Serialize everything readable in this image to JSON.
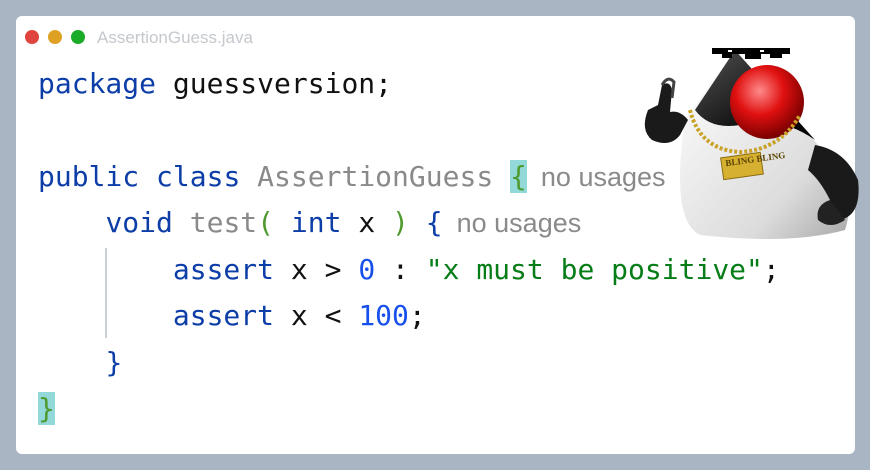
{
  "window": {
    "filename": "AssertionGuess.java"
  },
  "code": {
    "kw_package": "package",
    "package_rest": " guessversion;",
    "kw_public": "public",
    "kw_class": "class",
    "class_name": "AssertionGuess",
    "brace_open": "{",
    "class_hint": "no usages",
    "kw_void": "void",
    "method_name": "test",
    "paren_open": "(",
    "kw_int": "int",
    "param": " x ",
    "paren_close": ")",
    "method_hint": "no usages",
    "kw_assert": "assert",
    "assert1_mid": " x > ",
    "num_zero": "0",
    "colon": " : ",
    "message": "\"x must be positive\"",
    "semicolon": ";",
    "assert2_mid": " x < ",
    "num_hundred": "100",
    "brace_close": "}"
  },
  "image": {
    "badge_text": "BLING BLING",
    "icon": "duke-mascot-with-sunglasses-icon"
  },
  "colors": {
    "keyword": "#0d3ea8",
    "string": "#067d17",
    "number": "#1750eb",
    "match_highlight": "#93d9d9",
    "hint": "#8a8a8a"
  }
}
